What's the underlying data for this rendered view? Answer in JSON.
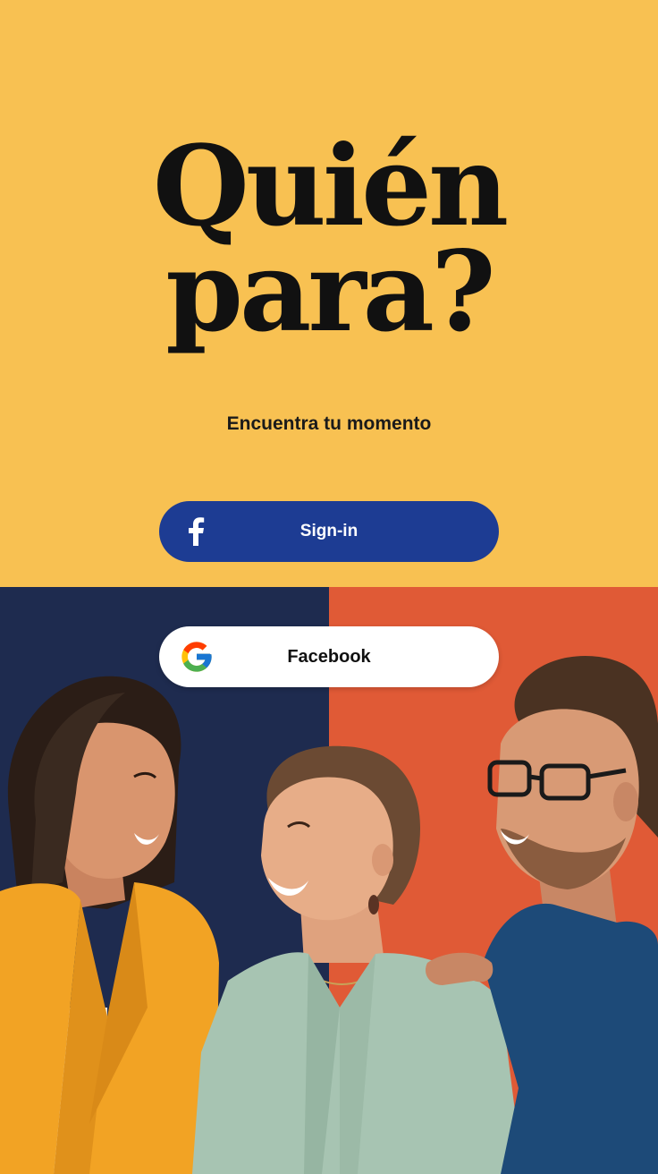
{
  "hero": {
    "title_line1": "Quién",
    "title_line2": "para?",
    "subtitle": "Encuentra tu momento"
  },
  "buttons": {
    "facebook": {
      "label": "Sign-in",
      "icon": "facebook-f-icon"
    },
    "google": {
      "label": "Facebook",
      "icon": "google-g-icon"
    }
  },
  "colors": {
    "top_background": "#F8C152",
    "bottom_left_background": "#1E2B4F",
    "bottom_right_background": "#E05A36",
    "facebook_button": "#1D3C93",
    "facebook_label": "#FFFFFF",
    "google_button": "#FFFFFF",
    "google_label": "#111111",
    "title": "#111111"
  },
  "photo": {
    "description_icon": "group-photo-image"
  }
}
